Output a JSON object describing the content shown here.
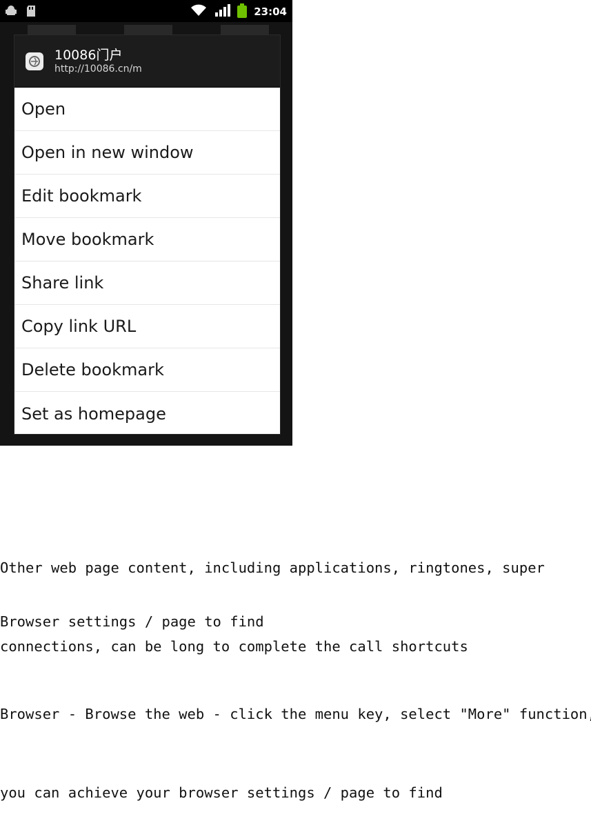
{
  "phone": {
    "status_bar": {
      "time": "23:04",
      "icons": [
        "android-debug-icon",
        "sd-card-icon",
        "wifi-icon",
        "signal-icon",
        "battery-icon"
      ]
    },
    "dialog": {
      "title": "10086门户",
      "url": "http://10086.cn/m",
      "icon": "web-page-icon",
      "items": [
        "Open",
        "Open in new window",
        "Edit bookmark",
        "Move bookmark",
        "Share link",
        "Copy link URL",
        "Delete bookmark",
        "Set as homepage"
      ]
    }
  },
  "document": {
    "paragraph1": [
      "Other web page content, including applications, ringtones, super",
      "connections, can be long to complete the call shortcuts"
    ],
    "heading": "Browser settings / page to find",
    "paragraph2": [
      "Browser - Browse the web - click the menu key, select \"More\" function,",
      "you can achieve your browser settings / page to find"
    ]
  }
}
